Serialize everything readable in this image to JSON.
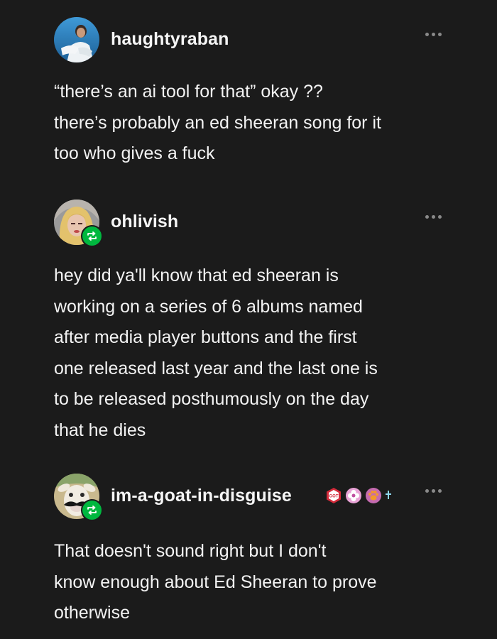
{
  "posts": [
    {
      "username": "haughtyraban",
      "reblog": false,
      "avatar_icon": "person-photo-avatar",
      "lines": [
        "“there’s an ai tool for that” okay ??",
        "there’s probably an ed sheeran song for it",
        "too who gives a fuck"
      ]
    },
    {
      "username": "ohlivish",
      "reblog": true,
      "avatar_icon": "redhead-photo-avatar",
      "lines": [
        "hey did ya'll know that ed sheeran is",
        "working on a series of 6 albums named",
        "after media player buttons and the first",
        "one released last year and the last one is",
        "to be released posthumously on the day",
        "that he dies"
      ]
    },
    {
      "username": "im-a-goat-in-disguise",
      "reblog": true,
      "avatar_icon": "goat-with-mustache-avatar",
      "badges": [
        "red-hex-badge",
        "pink-flower-badge",
        "paw-badge",
        "sparkle-badge"
      ],
      "badge_text": "GOT",
      "lines": [
        "That doesn't sound right but I don't",
        "know enough about Ed Sheeran to prove",
        "otherwise"
      ]
    }
  ],
  "colors": {
    "background": "#1b1b1b",
    "text": "#f3f3f3",
    "reblog_green": "#00b83f",
    "more_dots": "#8a8a8a"
  }
}
